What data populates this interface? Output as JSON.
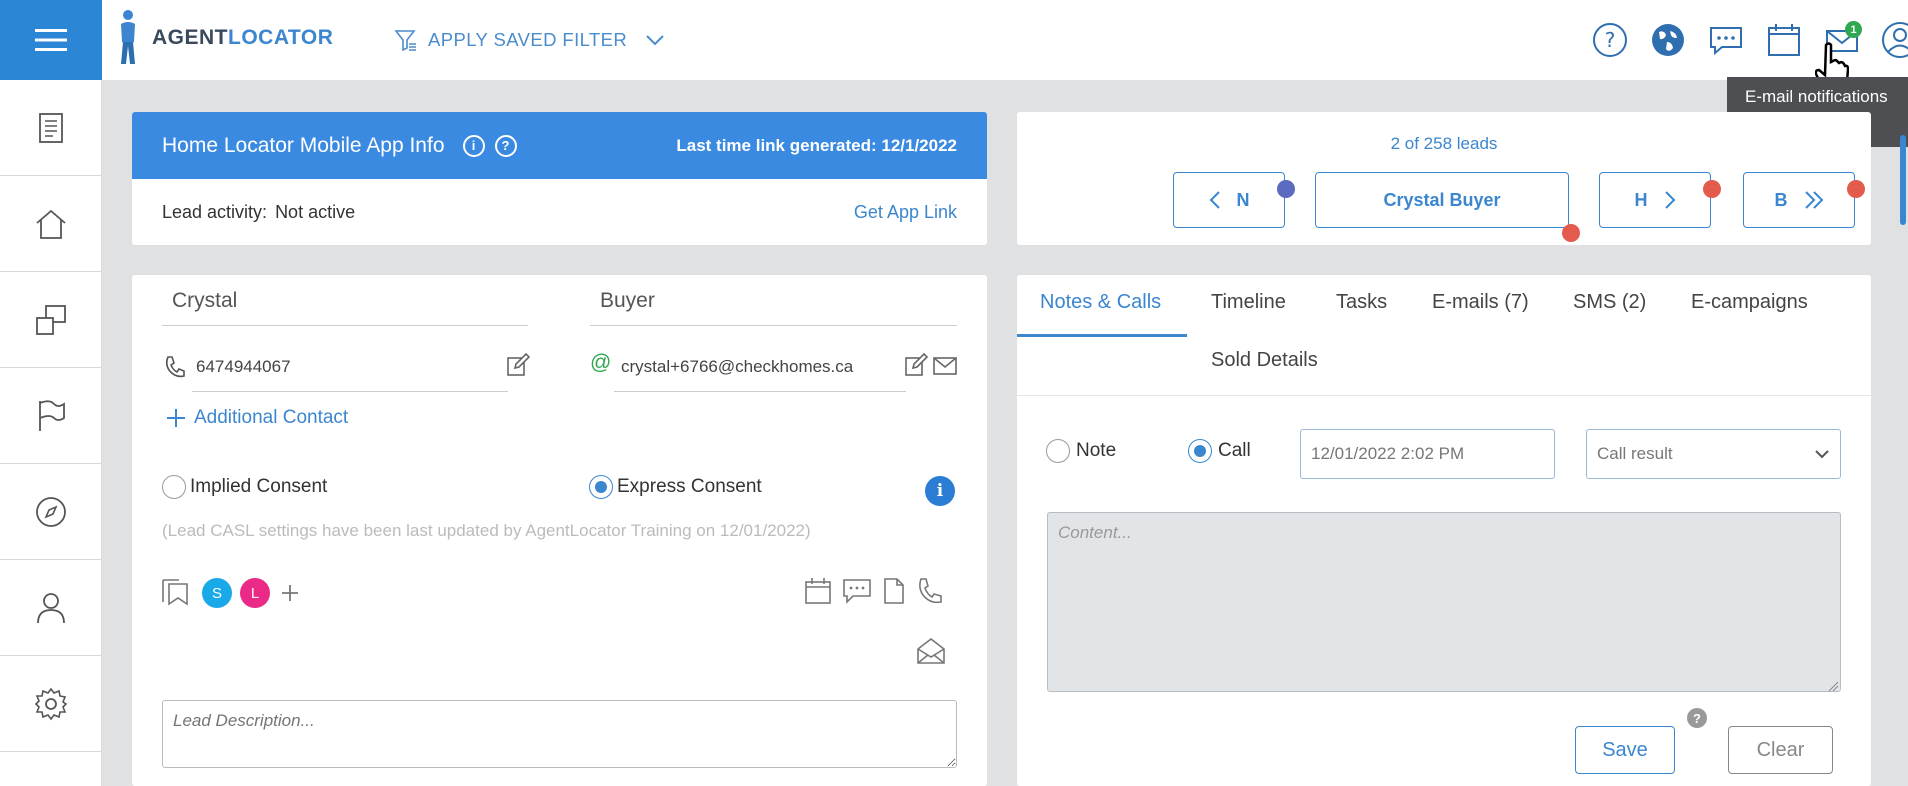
{
  "header": {
    "logo_part1": "AGENT",
    "logo_part2": "LOCATOR",
    "filter_label": "APPLY SAVED FILTER",
    "notification_count": "1",
    "tooltip": "E-mail notifications"
  },
  "icons": {
    "top": [
      "help-icon",
      "globe-icon",
      "chat-icon",
      "calendar-icon",
      "mail-icon",
      "user-circle-icon"
    ],
    "sidebar": [
      "document-icon",
      "home-icon",
      "listings-icon",
      "flag-icon",
      "compass-icon",
      "person-icon",
      "gear-icon"
    ]
  },
  "info": {
    "title": "Home Locator Mobile App Info",
    "last_link": "Last time link generated: 12/1/2022",
    "lead_activity_label": "Lead activity:",
    "lead_activity_value": "Not active",
    "get_link": "Get App Link"
  },
  "lead_nav": {
    "count": "2 of 258 leads",
    "prev_label": "N",
    "current_label": "Crystal Buyer",
    "next_label": "H",
    "last_label": "B"
  },
  "contact": {
    "first_name": "Crystal",
    "last_name": "Buyer",
    "phone": "6474944067",
    "email": "crystal+6766@checkhomes.ca",
    "additional_contact": "Additional Contact",
    "implied_consent": "Implied Consent",
    "express_consent": "Express Consent",
    "casl_note": "(Lead CASL settings have been last updated by AgentLocator Training on 12/01/2022)",
    "avatar_s": "S",
    "avatar_l": "L",
    "description_placeholder": "Lead Description..."
  },
  "notes": {
    "tabs": [
      "Notes & Calls",
      "Timeline",
      "Tasks",
      "E-mails (7)",
      "SMS (2)",
      "E-campaigns",
      "Sold Details"
    ],
    "note_label": "Note",
    "call_label": "Call",
    "datetime": "12/01/2022 2:02 PM",
    "call_result": "Call result",
    "content_placeholder": "Content...",
    "save": "Save",
    "clear": "Clear"
  },
  "colors": {
    "brand_blue": "#3b86cf",
    "header_blue": "#3b8ae2",
    "dot_purple": "#5b6bc0",
    "dot_red": "#e35b4c",
    "avatar_s": "#1aa9e8",
    "avatar_l": "#ea2a86"
  }
}
